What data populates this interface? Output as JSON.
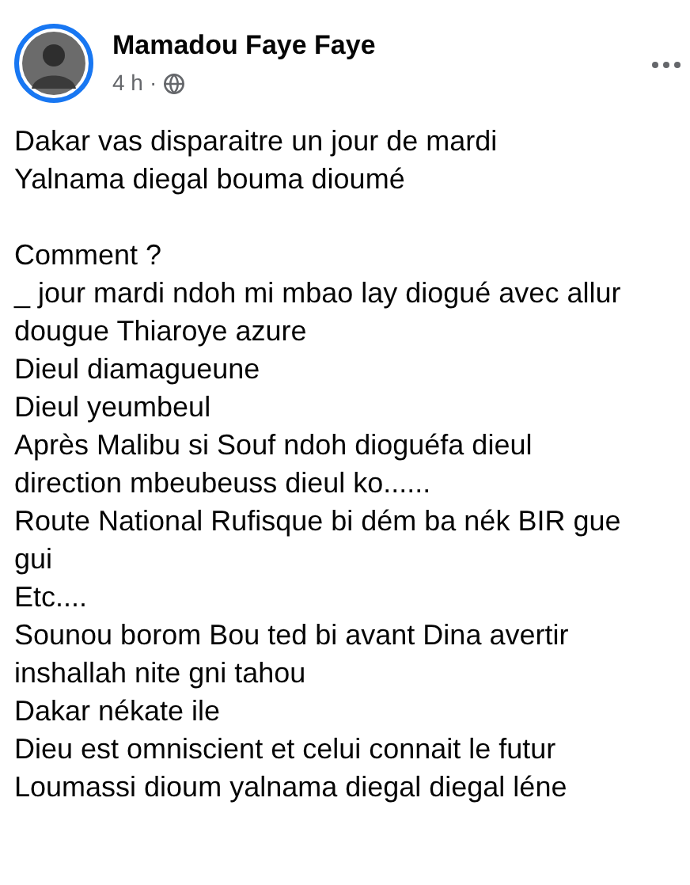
{
  "post": {
    "author": "Mamadou Faye Faye",
    "time": "4 h",
    "separator": "·",
    "paragraphs": [
      [
        "Dakar vas disparaitre un jour de mardi",
        "Yalnama diegal bouma dioumé"
      ],
      [
        "Comment ?",
        "_ jour mardi ndoh mi mbao lay diogué avec allur",
        "dougue Thiaroye azure",
        "Dieul diamagueune",
        "Dieul yeumbeul",
        "Après Malibu si Souf ndoh dioguéfa dieul",
        "direction mbeubeuss dieul ko......",
        "Route National Rufisque bi dém ba nék BIR gue",
        "gui",
        "Etc....",
        "Sounou borom Bou ted bi avant Dina avertir",
        "inshallah nite gni tahou",
        "Dakar nékate ile",
        "Dieu est omniscient et celui connait le futur",
        "Loumassi dioum yalnama diegal diegal léne"
      ]
    ]
  }
}
